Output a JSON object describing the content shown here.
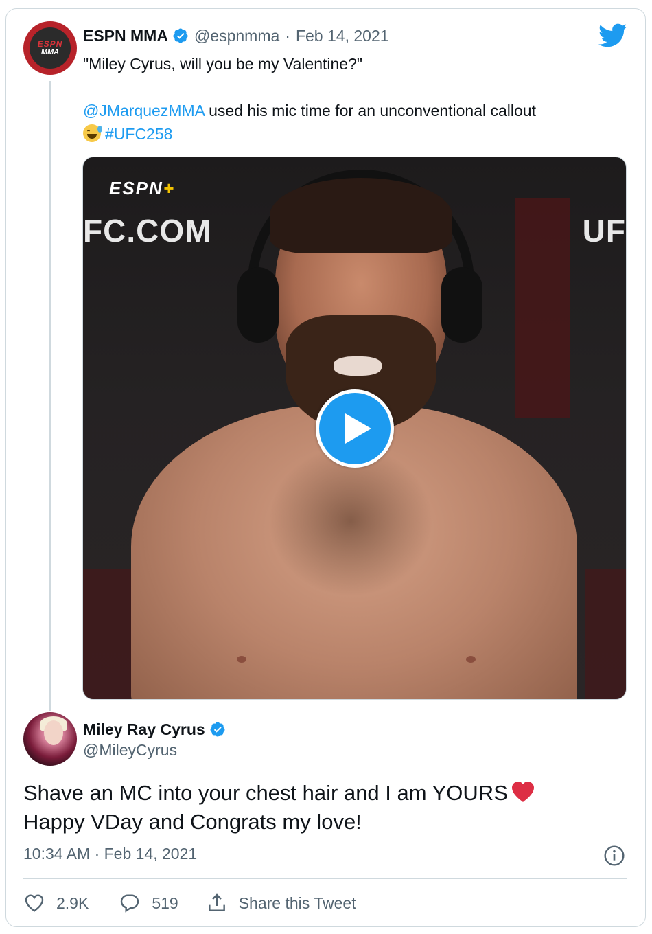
{
  "parent_tweet": {
    "author_name": "ESPN MMA",
    "handle": "@espnmma",
    "separator": "·",
    "date": "Feb 14, 2021",
    "avatar_text_top": "ESPN",
    "avatar_text_bottom": "MMA",
    "text_line1": "\"Miley Cyrus, will you be my Valentine?\"",
    "mention": "@JMarquezMMA",
    "text_line2": " used his mic time for an unconventional callout",
    "hashtag": "#UFC258",
    "video": {
      "overlay_brand": "ESPN",
      "overlay_brand_plus": "+",
      "overlay_left": "FC.COM",
      "overlay_right": "UF"
    }
  },
  "reply_tweet": {
    "author_name": "Miley Ray Cyrus",
    "handle": "@MileyCyrus",
    "text_line1": "Shave an MC into your chest hair and I am YOURS",
    "text_line2": "Happy VDay and Congrats my love!",
    "timestamp": "10:34 AM · Feb 14, 2021"
  },
  "actions": {
    "likes": "2.9K",
    "replies": "519",
    "share_label": "Share this Tweet"
  },
  "colors": {
    "accent": "#1d9bf0",
    "muted": "#536471",
    "heart": "#e0245e",
    "espn_red": "#b7232a"
  },
  "icons": [
    "verified-badge-icon",
    "twitter-bird-icon",
    "play-icon",
    "info-icon",
    "heart-icon",
    "reply-icon",
    "share-icon",
    "grinning-sweat-emoji",
    "red-heart-emoji"
  ]
}
